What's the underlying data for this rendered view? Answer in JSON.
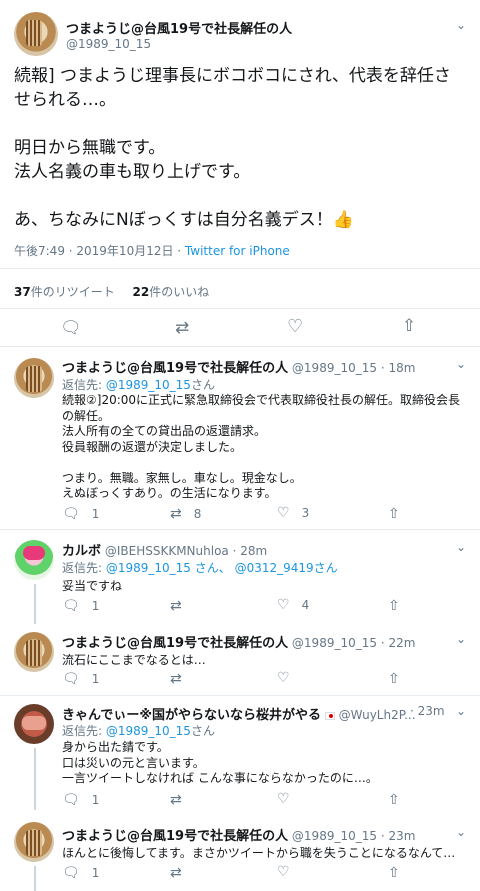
{
  "main_tweet": {
    "name": "つまようじ@台風19号で社長解任の人",
    "handle": "@1989_10_15",
    "text": "続報] つまようじ理事長にボコボコにされ、代表を辞任させられる…。\n\n明日から無職です。\n法人名義の車も取り上げです。\n\nあ、ちなみにNぼっくすは自分名義デス！",
    "emoji": "👍",
    "time": "午後7:49 · 2019年10月12日 · ",
    "source": "Twitter for iPhone",
    "retweets_count": "37",
    "retweets_label": "件のリツイート",
    "likes_count": "22",
    "likes_label": "件のいいね"
  },
  "icons": {
    "reply": "reply-icon",
    "retweet": "retweet-icon",
    "like": "like-icon",
    "share": "share-icon",
    "chevron": "chevron-down-icon"
  },
  "replies": [
    {
      "name": "つまようじ@台風19号で社長解任の人",
      "handle": "@1989_10_15",
      "time": "· 18m",
      "reply_to_label": "返信先: ",
      "reply_to": "@1989_10_15",
      "reply_to_suffix": "さん",
      "text": "続報②]20:00に正式に緊急取締役会で代表取締役社長の解任。取締役会長の解任。\n法人所有の全ての貸出品の返還請求。\n役員報酬の返還が決定しました。\n\nつまり。無職。家無し。車なし。現金なし。\nえぬぼっくすあり。の生活になります。",
      "reply_count": "1",
      "retweet_count": "8",
      "like_count": "3"
    },
    {
      "name": "カルボ",
      "handle": "@IBEHSSKKMNuhloa",
      "time": "· 28m",
      "reply_to_label": "返信先: ",
      "reply_to": "@1989_10_15 さん、 @0312_9419さん",
      "text": "妥当ですね",
      "reply_count": "1",
      "like_count": "4"
    },
    {
      "name": "つまようじ@台風19号で社長解任の人",
      "handle": "@1989_10_15",
      "time": "· 22m",
      "text": "流石にここまでなるとは…",
      "reply_count": "1"
    },
    {
      "name": "きゃんでぃー※国がやらないなら桜井がやる",
      "handle": "@WuyLh2P...",
      "time": "· 23m",
      "reply_to_label": "返信先: ",
      "reply_to": "@1989_10_15",
      "reply_to_suffix": "さん",
      "text": "身から出た錆です。\n口は災いの元と言います。\n一言ツイートしなければ こんな事にならなかったのに…。",
      "reply_count": "1"
    },
    {
      "name": "つまようじ@台風19号で社長解任の人",
      "handle": "@1989_10_15",
      "time": "· 23m",
      "text": "ほんとに後悔してます。まさかツイートから職を失うことになるなんて…",
      "reply_count": "1"
    }
  ]
}
